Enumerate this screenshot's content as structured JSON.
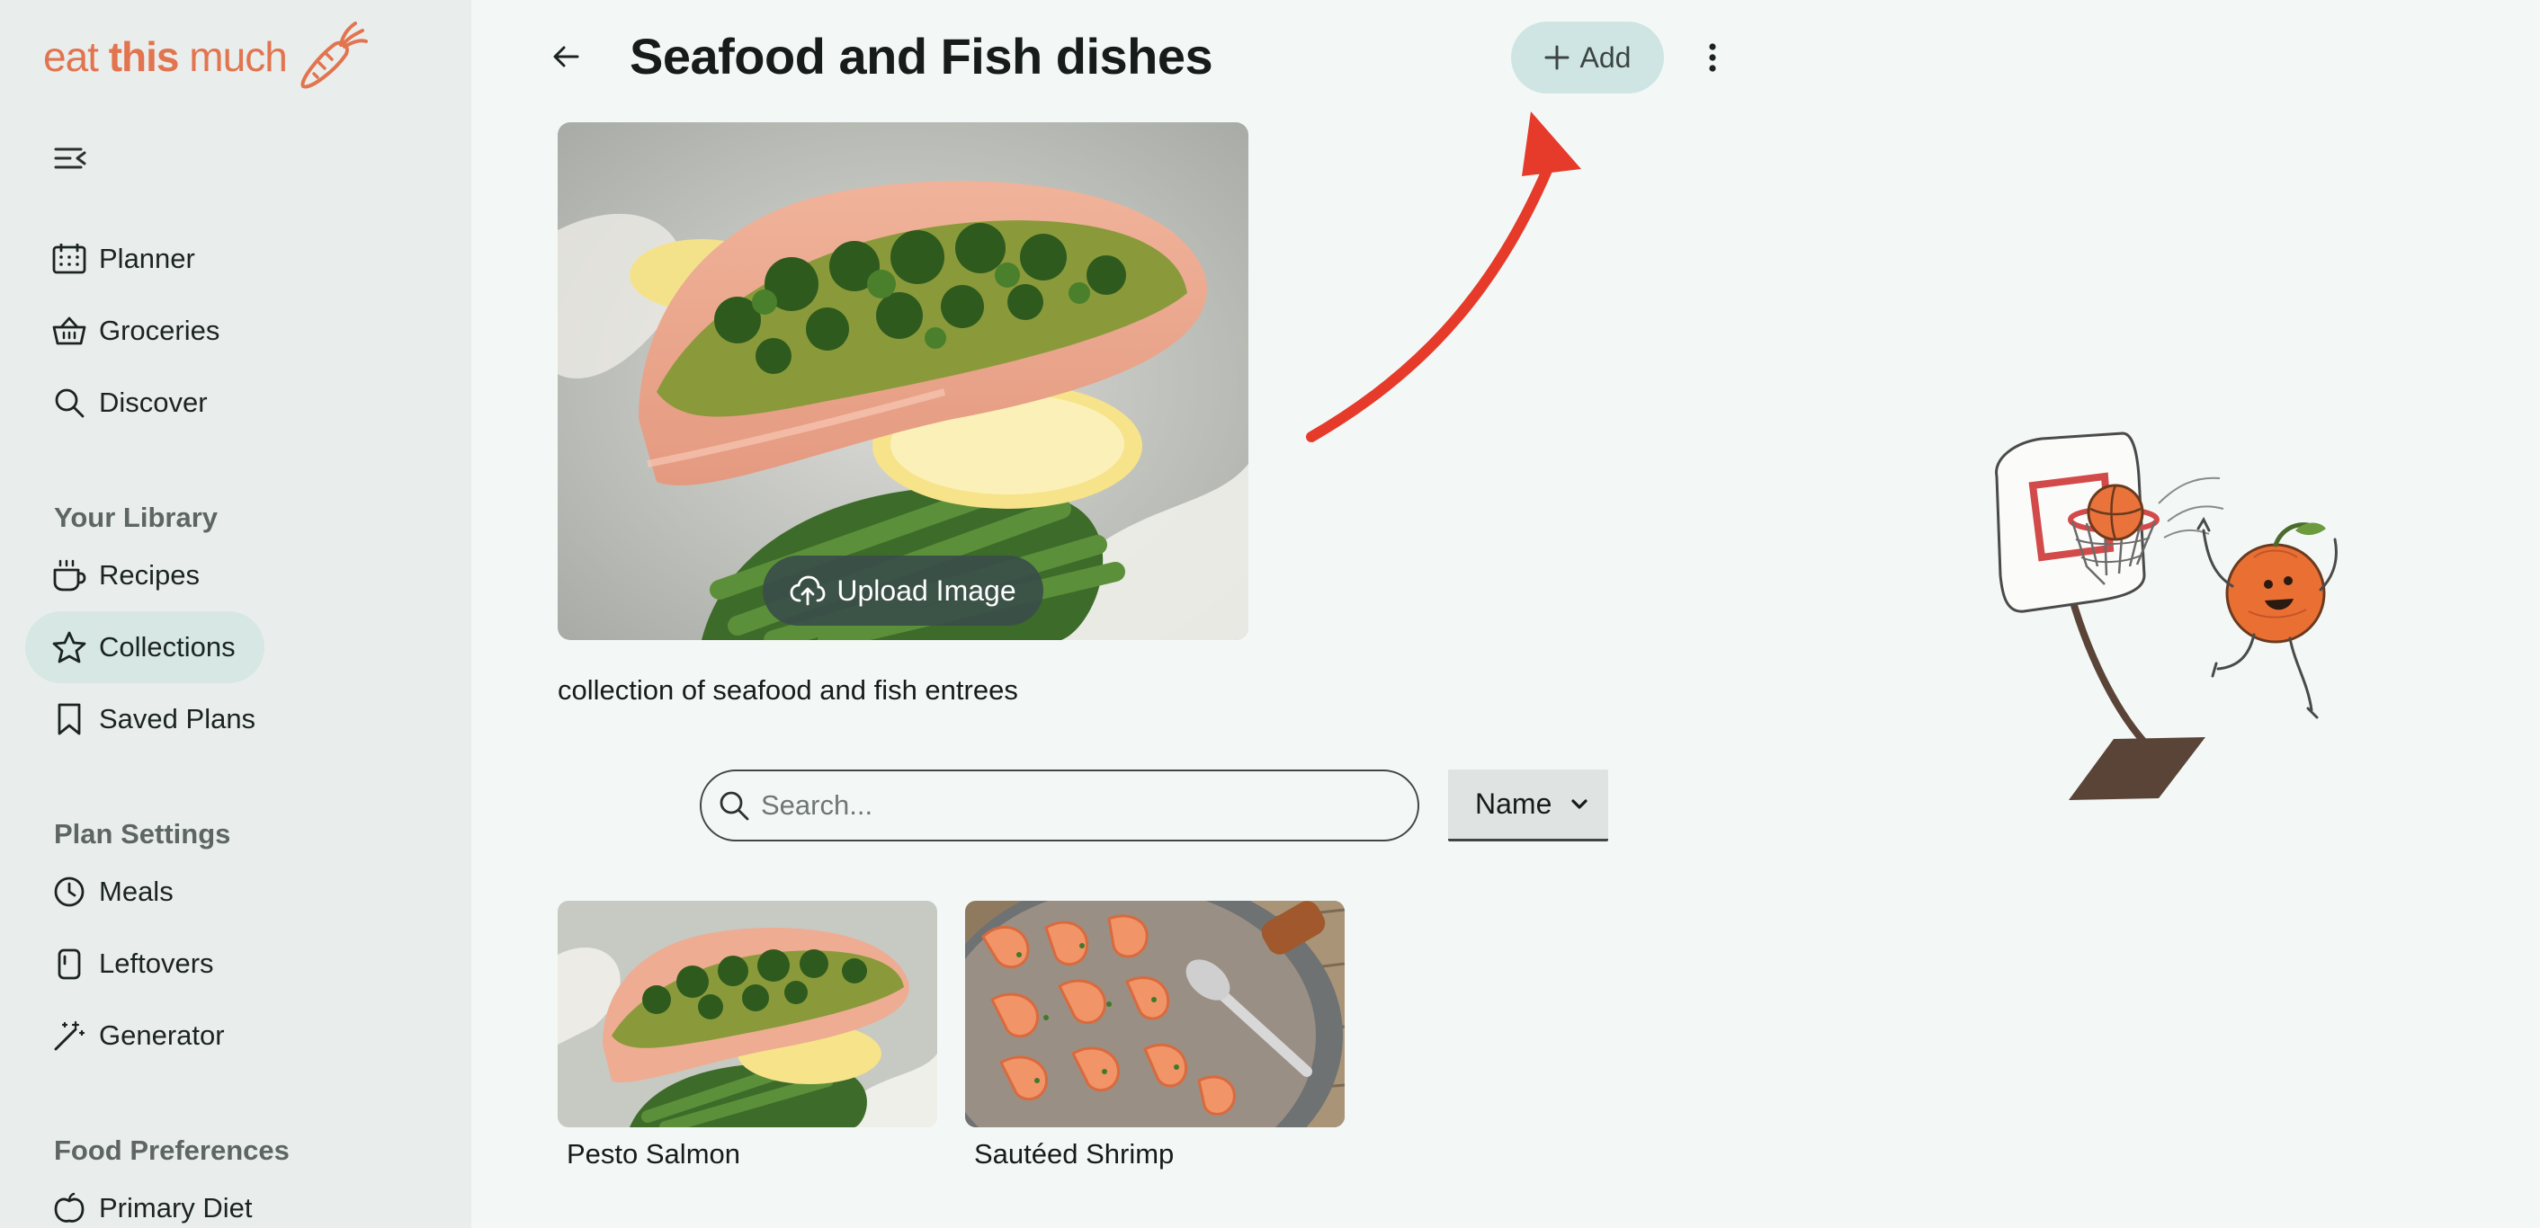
{
  "logo": {
    "word1": "eat ",
    "word2": "this",
    "word3": " much"
  },
  "sidebar": {
    "top_items": [
      {
        "label": "Planner",
        "icon": "calendar-icon"
      },
      {
        "label": "Groceries",
        "icon": "basket-icon"
      },
      {
        "label": "Discover",
        "icon": "search-icon"
      }
    ],
    "library_title": "Your Library",
    "library_items": [
      {
        "label": "Recipes",
        "icon": "cup-icon"
      },
      {
        "label": "Collections",
        "icon": "star-icon",
        "active": true
      },
      {
        "label": "Saved Plans",
        "icon": "bookmark-icon"
      }
    ],
    "plan_settings_title": "Plan Settings",
    "plan_items": [
      {
        "label": "Meals",
        "icon": "clock-icon"
      },
      {
        "label": "Leftovers",
        "icon": "container-icon"
      },
      {
        "label": "Generator",
        "icon": "magic-wand-icon"
      }
    ],
    "food_pref_title": "Food Preferences",
    "food_items": [
      {
        "label": "Primary Diet",
        "icon": "apple-icon"
      }
    ]
  },
  "header": {
    "title": "Seafood and Fish dishes",
    "add_label": "Add"
  },
  "collection": {
    "upload_label": "Upload Image",
    "description": "collection of seafood and fish entrees"
  },
  "search": {
    "placeholder": "Search..."
  },
  "sort": {
    "selected": "Name"
  },
  "recipes": [
    {
      "name": "Pesto Salmon"
    },
    {
      "name": "Sautéed Shrimp"
    }
  ],
  "colors": {
    "brand": "#e2744f",
    "accent": "#cfe5e3",
    "annotation_arrow": "#e63a2a",
    "sidebar_bg": "#e9eeec",
    "page_bg": "#f3f8f7"
  }
}
